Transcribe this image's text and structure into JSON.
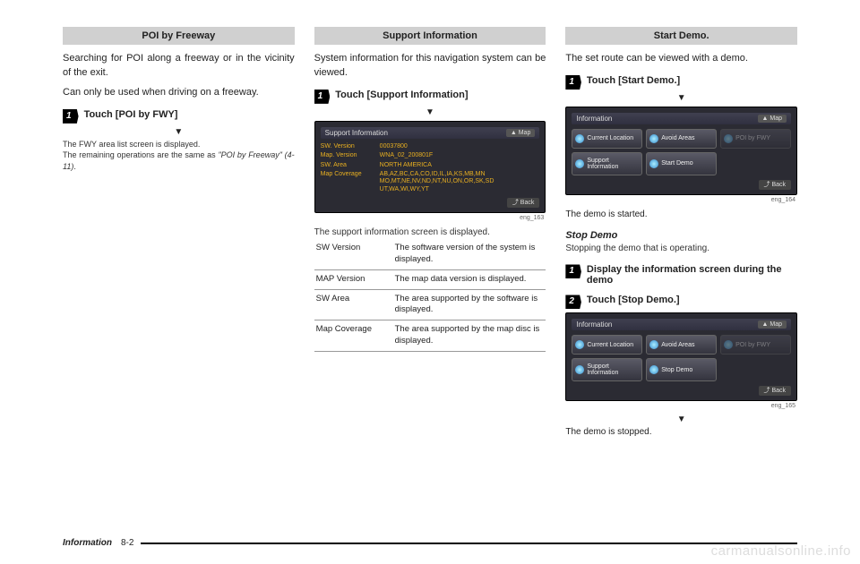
{
  "col1": {
    "heading": "POI by Freeway",
    "p1": "Searching for POI along a freeway or in the vicinity of the exit.",
    "p2": "Can only be used when driving on a freeway.",
    "step1_num": "1",
    "step1_label": "Touch [POI by FWY]",
    "fine1": "The FWY area list screen is displayed.",
    "fine2a": "The remaining operations are the same as ",
    "fine2b": "\"POI by Freeway\" (4-11)",
    "fine2c": "."
  },
  "col2": {
    "heading": "Support Information",
    "p1": "System information for this navigation system can be viewed.",
    "step1_num": "1",
    "step1_label": "Touch [Support Information]",
    "ss": {
      "title": "Support Information",
      "map": "▲ Map",
      "r1l": "SW. Version",
      "r1r": "00037800",
      "r2l": "Map. Version",
      "r2r": "WNA_02_200801F",
      "r3l": "SW. Area",
      "r3r": "NORTH AMERICA",
      "r4l": "Map Coverage",
      "r4r": "AB,AZ,BC,CA,CO,ID,IL,IA,KS,MB,MN MO,MT,NE,NV,ND,NT,NU,ON,OR,SK,SD UT,WA,WI,WY,YT",
      "back": "⤴ Back"
    },
    "ss_cap": "eng_163",
    "after": "The support information screen is displayed.",
    "table": {
      "r1a": "SW Version",
      "r1b": "The software version of the system is displayed.",
      "r2a": "MAP Version",
      "r2b": "The map data version is displayed.",
      "r3a": "SW Area",
      "r3b": "The area supported by the software is displayed.",
      "r4a": "Map Coverage",
      "r4b": "The area supported by the map disc is displayed."
    }
  },
  "col3": {
    "heading": "Start Demo.",
    "p1": "The set route can be viewed with a demo.",
    "step1_num": "1",
    "step1_label": "Touch [Start Demo.]",
    "ss1": {
      "title": "Information",
      "map": "▲ Map",
      "b1": "Current Location",
      "b2": "Avoid Areas",
      "b3": "POI by FWY",
      "b4": "Support Information",
      "b5": "Start Demo",
      "back": "⤴ Back"
    },
    "ss1_cap": "eng_164",
    "after1": "The demo is started.",
    "sub": "Stop Demo",
    "subp": "Stopping the demo that is operating.",
    "step2a_num": "1",
    "step2a_label": "Display the information screen during the demo",
    "step2b_num": "2",
    "step2b_label": "Touch [Stop Demo.]",
    "ss2": {
      "title": "Information",
      "map": "▲ Map",
      "b1": "Current Location",
      "b2": "Avoid Areas",
      "b3": "POI by FWY",
      "b4": "Support Information",
      "b5": "Stop Demo",
      "back": "⤴ Back"
    },
    "ss2_cap": "eng_165",
    "after2": "The demo is stopped."
  },
  "footer": {
    "section": "Information",
    "page": "8-2"
  },
  "watermark": "carmanualsonline.info"
}
